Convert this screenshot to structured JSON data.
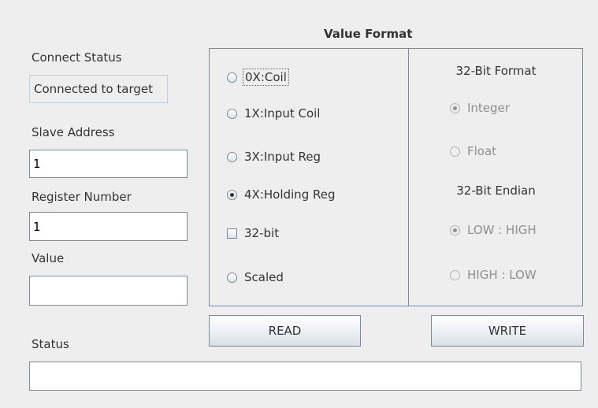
{
  "left": {
    "connect_status_label": "Connect Status",
    "connect_status_value": "Connected to target",
    "slave_address_label": "Slave Address",
    "slave_address_value": "1",
    "register_number_label": "Register Number",
    "register_number_value": "1",
    "value_label": "Value",
    "value_value": "",
    "status_label": "Status",
    "status_value": ""
  },
  "value_format": {
    "title": "Value Format",
    "coil": "0X:Coil",
    "input_coil": "1X:Input Coil",
    "input_reg": "3X:Input Reg",
    "holding_reg": "4X:Holding Reg",
    "bit32": "32-bit",
    "scaled": "Scaled",
    "selected": "4X:Holding Reg"
  },
  "format32": {
    "title": "32-Bit Format",
    "integer": "Integer",
    "float": "Float",
    "selected": "Integer",
    "endian_title": "32-Bit Endian",
    "low_high": "LOW : HIGH",
    "high_low": "HIGH : LOW",
    "endian_selected": "LOW : HIGH"
  },
  "buttons": {
    "read": "READ",
    "write": "WRITE"
  },
  "colors": {
    "background": "#eeeeee",
    "border": "#7a8a99",
    "readout_border": "#b8cfe5",
    "disabled_text": "#8e8f91"
  }
}
